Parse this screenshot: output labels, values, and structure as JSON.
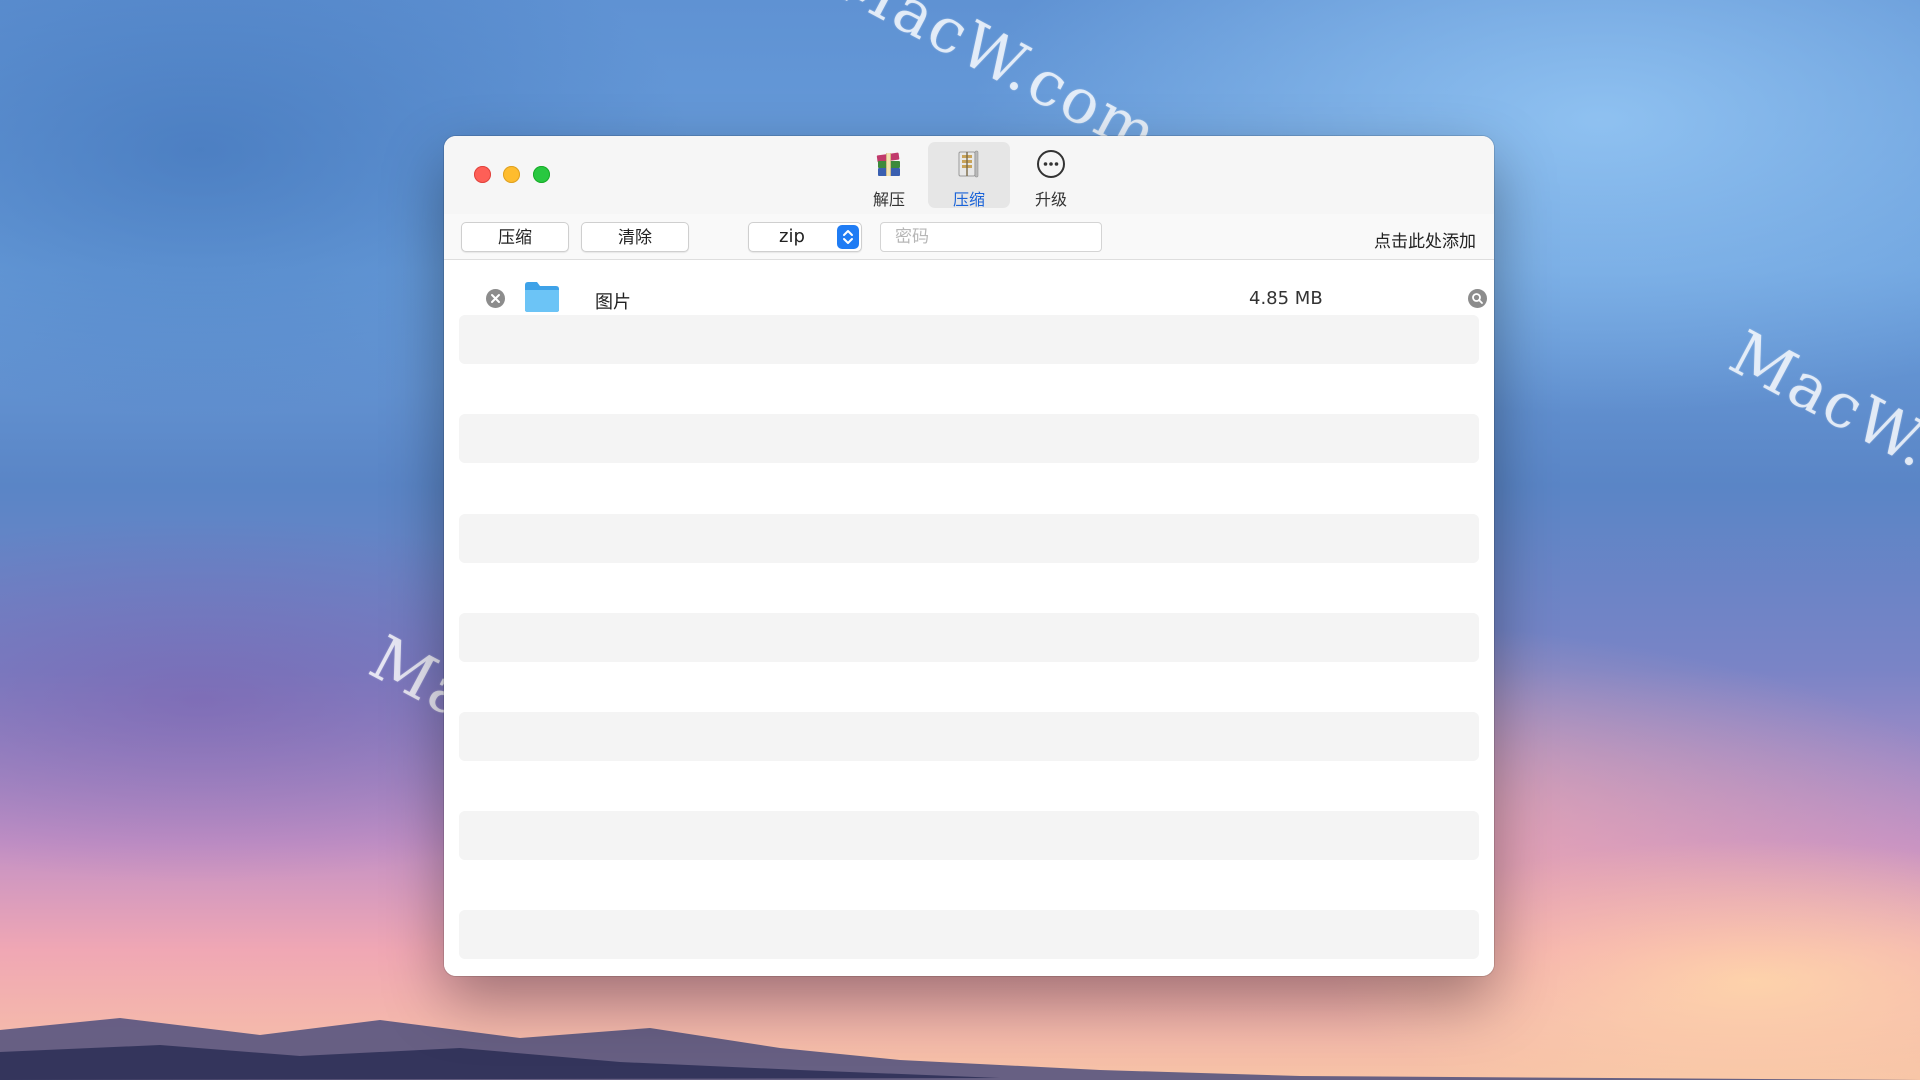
{
  "watermark": {
    "text": "MacW.com"
  },
  "window": {
    "toolbar_tabs": [
      {
        "label": "解压",
        "icon": "archive-books-icon",
        "active": false
      },
      {
        "label": "压缩",
        "icon": "zip-file-icon",
        "active": true
      },
      {
        "label": "升级",
        "icon": "more-circle-icon",
        "active": false
      }
    ],
    "actions": {
      "compress_label": "压缩",
      "clear_label": "清除",
      "format_value": "zip",
      "password_placeholder": "密码",
      "password_value": "",
      "add_hint": "点击此处添加"
    },
    "files": [
      {
        "name": "图片",
        "size": "4.85 MB",
        "icon": "folder-icon"
      }
    ]
  },
  "colors": {
    "accent": "#1f7cf4",
    "active_tab_label": "#1a63d8",
    "close": "#fe5f57",
    "minimize": "#febc2e",
    "maximize": "#28c840",
    "folder": "#5bb5ef"
  }
}
